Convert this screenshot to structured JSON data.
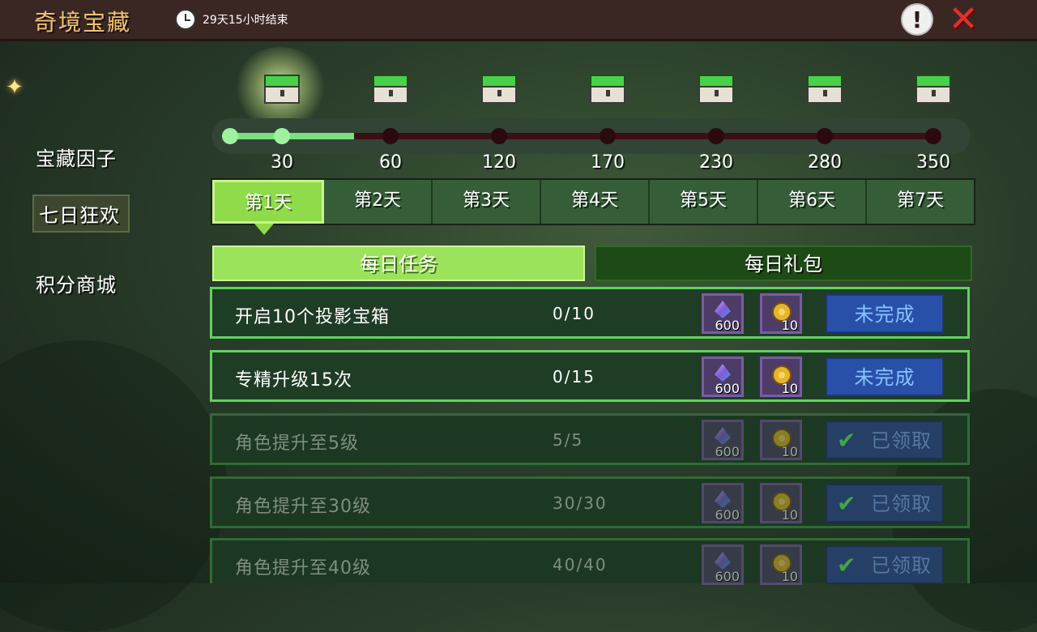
{
  "header": {
    "title": "奇境宝藏",
    "timer_text": "29天15小时结束",
    "info_label": "!",
    "close_label": "✕"
  },
  "sidebar": {
    "items": [
      {
        "label": "宝藏因子",
        "active": false
      },
      {
        "label": "七日狂欢",
        "active": true
      },
      {
        "label": "积分商城",
        "active": false
      }
    ]
  },
  "progress": {
    "current_points": 50,
    "milestones": [
      "30",
      "60",
      "120",
      "170",
      "230",
      "280",
      "350"
    ]
  },
  "days": {
    "tabs": [
      "第1天",
      "第2天",
      "第3天",
      "第4天",
      "第5天",
      "第6天",
      "第7天"
    ],
    "active_index": 0
  },
  "subtabs": {
    "daily_tasks": "每日任务",
    "daily_pack": "每日礼包"
  },
  "tasks": [
    {
      "name": "开启10个投影宝箱",
      "progress": "0/10",
      "gem_qty": "600",
      "coin_qty": "10",
      "status": "未完成"
    },
    {
      "name": "专精升级15次",
      "progress": "0/15",
      "gem_qty": "600",
      "coin_qty": "10",
      "status": "未完成"
    },
    {
      "name": "角色提升至5级",
      "progress": "5/5",
      "gem_qty": "600",
      "coin_qty": "10",
      "status": "已领取"
    },
    {
      "name": "角色提升至30级",
      "progress": "30/30",
      "gem_qty": "600",
      "coin_qty": "10",
      "status": "已领取"
    },
    {
      "name": "角色提升至40级",
      "progress": "40/40",
      "gem_qty": "600",
      "coin_qty": "10",
      "status": "已领取"
    }
  ],
  "icons": {
    "chest": "treasure-chest-icon",
    "clock": "clock-icon",
    "gem": "gem-icon",
    "coin": "coin-icon",
    "check": "checkmark-icon"
  },
  "colors": {
    "active_green": "#8fdb4a",
    "incomplete_button": "#2950a8",
    "close_red": "#e0302a",
    "title_gold": "#f3c36d"
  }
}
